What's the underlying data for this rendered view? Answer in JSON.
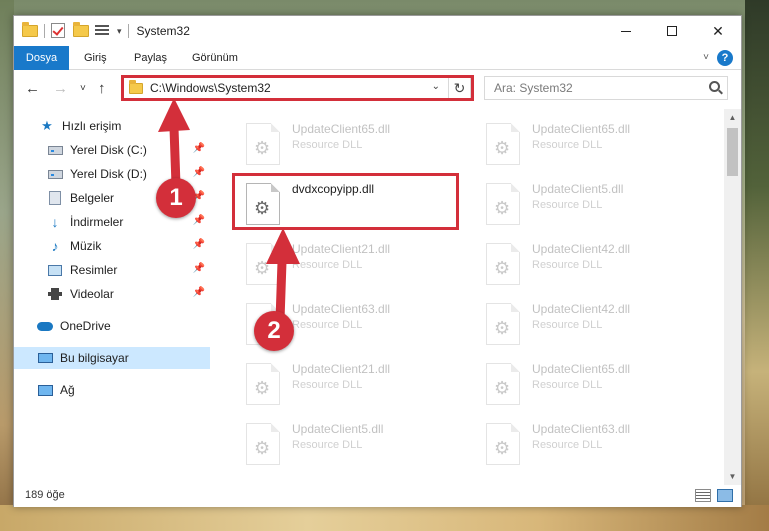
{
  "window": {
    "title": "System32"
  },
  "ribbon": {
    "tabs": [
      "Dosya",
      "Giriş",
      "Paylaş",
      "Görünüm"
    ]
  },
  "navigation": {
    "address": "C:\\Windows\\System32",
    "search_placeholder": "Ara: System32"
  },
  "sidebar": {
    "items": [
      {
        "label": "Hızlı erişim",
        "icon": "star-icon"
      },
      {
        "label": "Yerel Disk (C:)",
        "icon": "drive-icon",
        "pinned": true
      },
      {
        "label": "Yerel Disk (D:)",
        "icon": "drive-icon",
        "pinned": true
      },
      {
        "label": "Belgeler",
        "icon": "documents-icon",
        "pinned": true
      },
      {
        "label": "İndirmeler",
        "icon": "download-icon",
        "pinned": true
      },
      {
        "label": "Müzik",
        "icon": "music-icon",
        "pinned": true
      },
      {
        "label": "Resimler",
        "icon": "pictures-icon",
        "pinned": true
      },
      {
        "label": "Videolar",
        "icon": "videos-icon",
        "pinned": true
      },
      {
        "label": "OneDrive",
        "icon": "cloud-icon"
      },
      {
        "label": "Bu bilgisayar",
        "icon": "computer-icon",
        "selected": true
      },
      {
        "label": "Ağ",
        "icon": "network-icon"
      }
    ]
  },
  "files": [
    {
      "name": "UpdateClient65.dll",
      "type": "Resource DLL"
    },
    {
      "name": "UpdateClient65.dll",
      "type": "Resource DLL"
    },
    {
      "name": "dvdxcopyipp.dll",
      "type": "",
      "highlighted": true
    },
    {
      "name": "UpdateClient5.dll",
      "type": "Resource DLL"
    },
    {
      "name": "UpdateClient21.dll",
      "type": "Resource DLL"
    },
    {
      "name": "UpdateClient42.dll",
      "type": "Resource DLL"
    },
    {
      "name": "UpdateClient63.dll",
      "type": "Resource DLL"
    },
    {
      "name": "UpdateClient42.dll",
      "type": "Resource DLL"
    },
    {
      "name": "UpdateClient21.dll",
      "type": "Resource DLL"
    },
    {
      "name": "UpdateClient65.dll",
      "type": "Resource DLL"
    },
    {
      "name": "UpdateClient5.dll",
      "type": "Resource DLL"
    },
    {
      "name": "UpdateClient63.dll",
      "type": "Resource DLL"
    }
  ],
  "status": {
    "item_count": "189 öğe"
  },
  "annotations": {
    "step1": "1",
    "step2": "2",
    "color": "#d32f3a"
  },
  "colors": {
    "accent": "#1979ca",
    "selection": "#cce8ff"
  }
}
